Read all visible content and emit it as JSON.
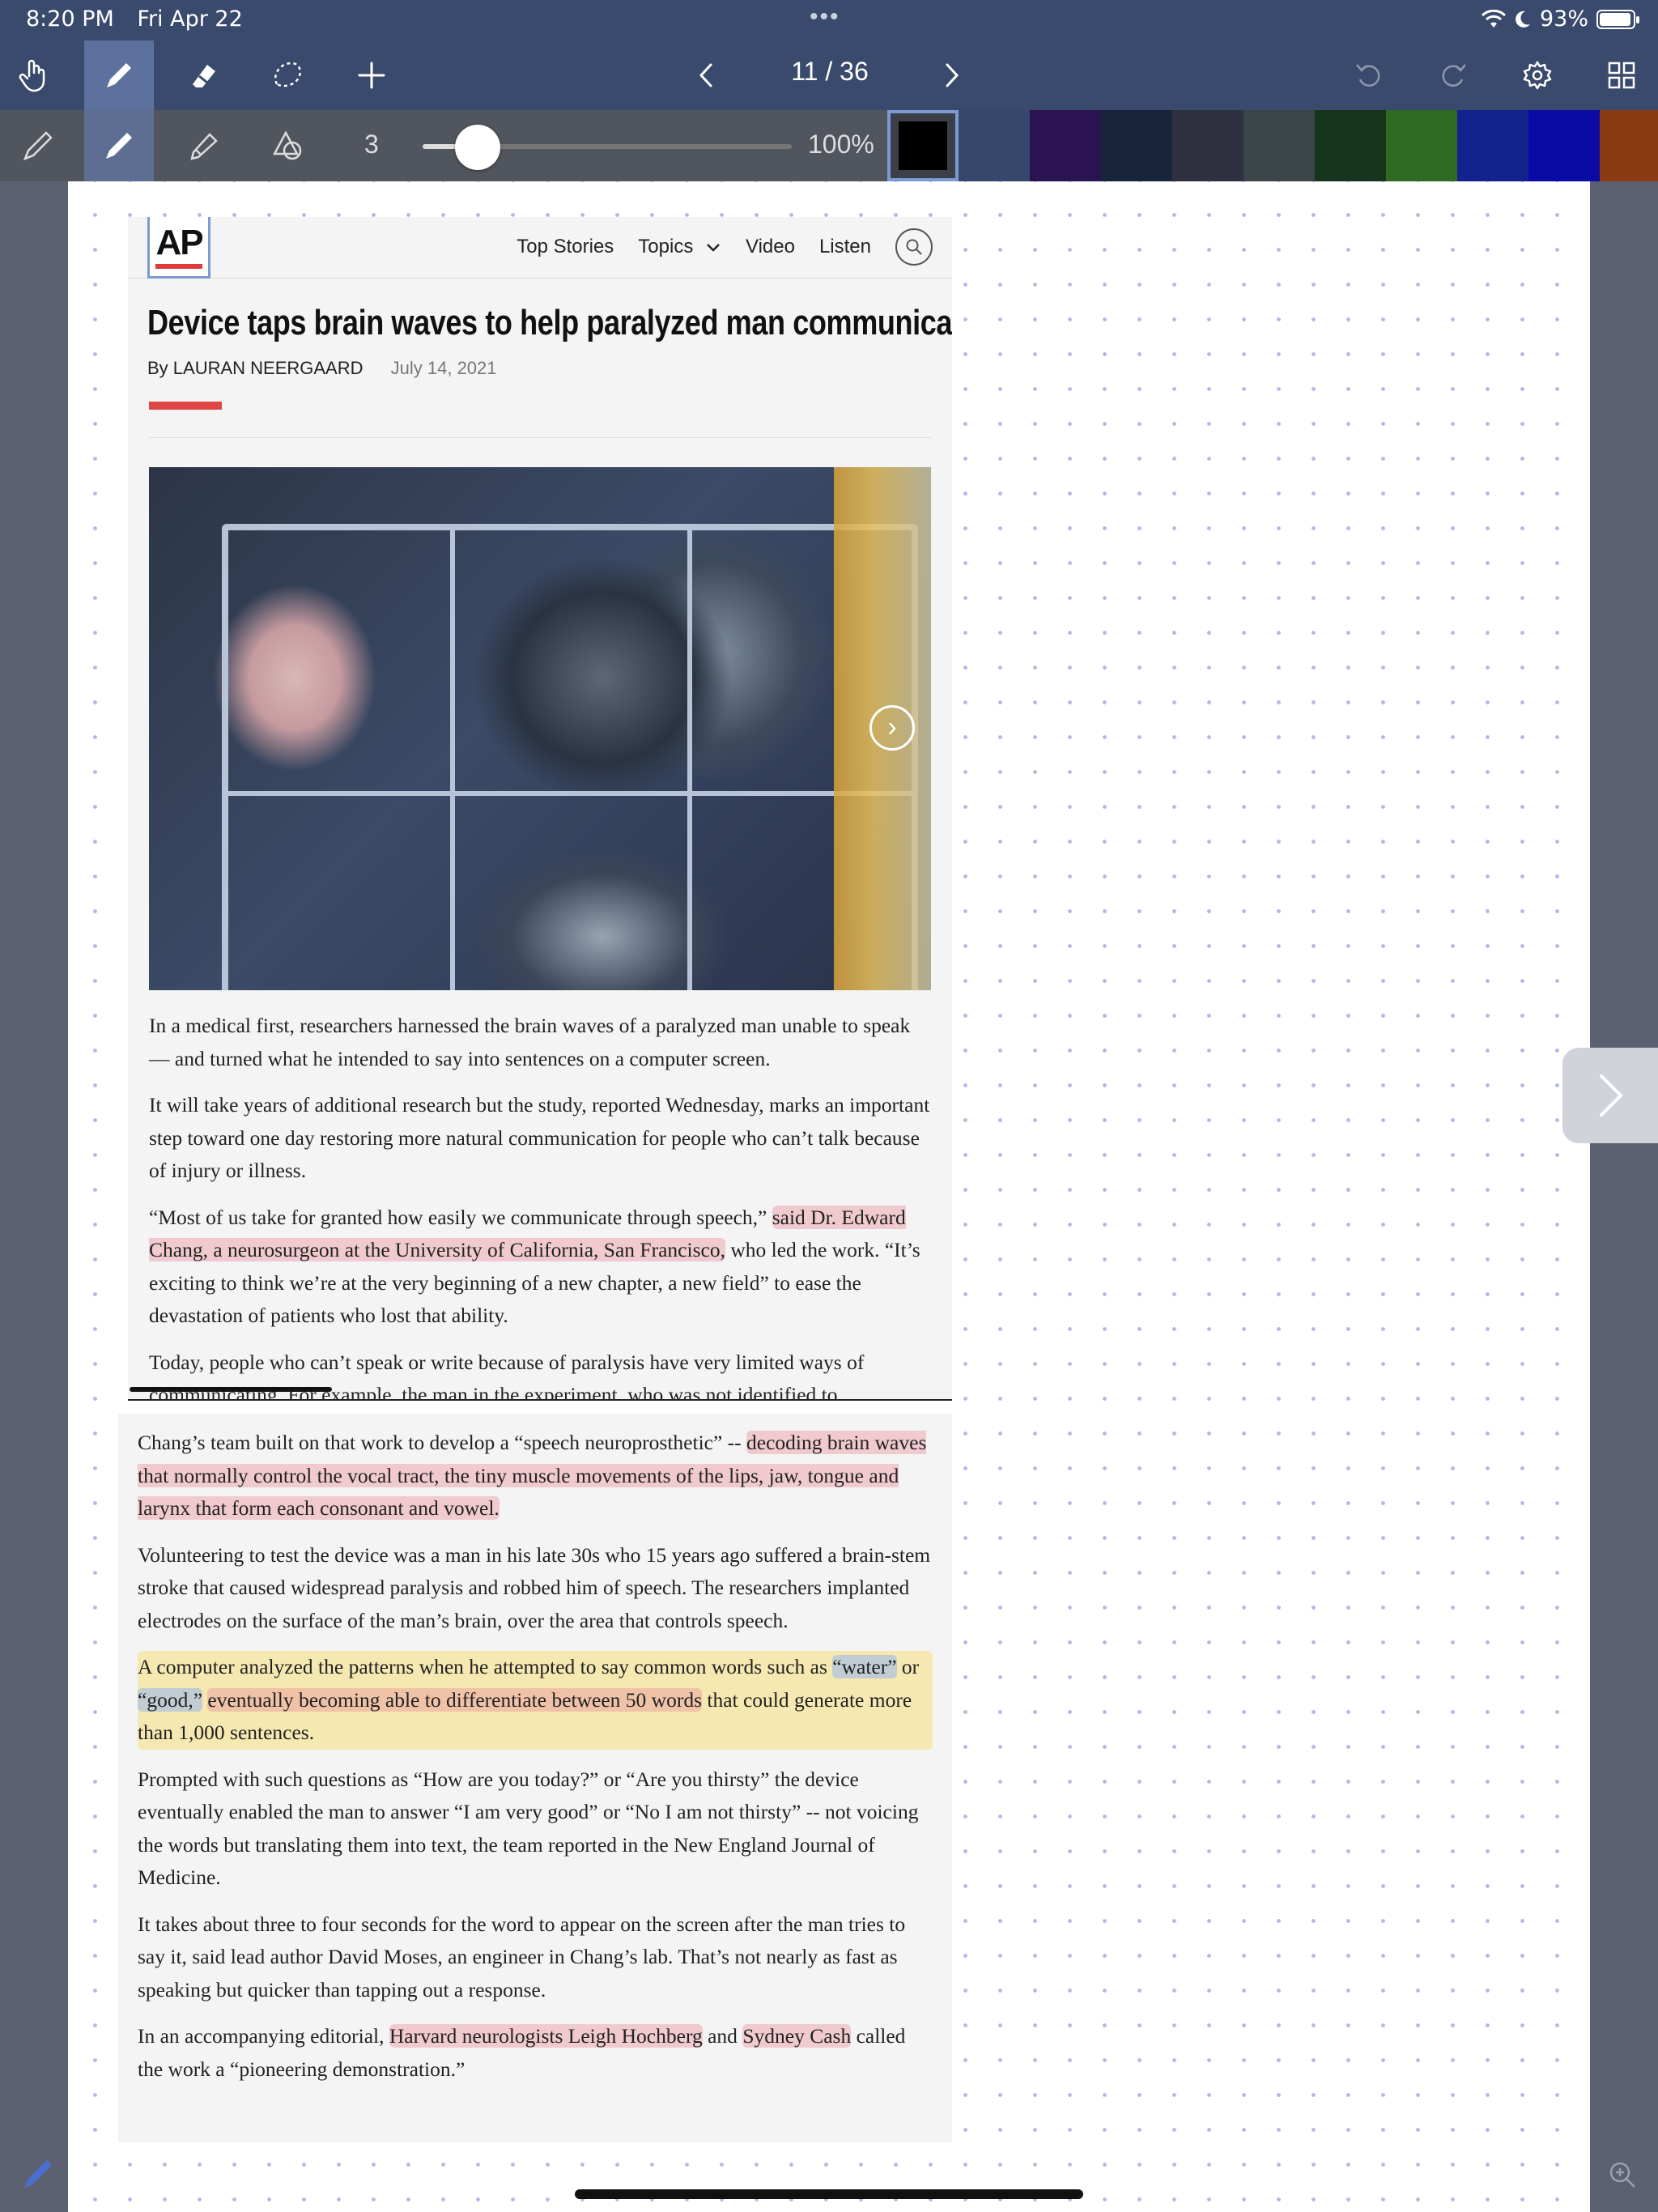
{
  "status_bar": {
    "time": "8:20 PM",
    "date": "Fri Apr 22",
    "dots": "•••",
    "battery": "93%"
  },
  "toolbar": {
    "tools": [
      {
        "name": "hand-tool",
        "icon": "hand-icon",
        "active": false
      },
      {
        "name": "pen-tool",
        "icon": "pen-icon",
        "active": true
      },
      {
        "name": "eraser-tool",
        "icon": "eraser-icon",
        "active": false
      },
      {
        "name": "lasso-tool",
        "icon": "lasso-icon",
        "active": false
      },
      {
        "name": "add-tool",
        "icon": "plus-icon",
        "active": false
      }
    ],
    "page_indicator": "11 / 36",
    "right": [
      "undo-icon",
      "redo-icon",
      "gear-icon",
      "grid-icon"
    ]
  },
  "pen_bar": {
    "pens": [
      "fountain-pen-icon",
      "ballpoint-pen-icon",
      "highlighter-icon",
      "shapes-icon"
    ],
    "size": "3",
    "slider_value": 0.15,
    "opacity": "100%",
    "colors": [
      "#000000",
      "#35476a",
      "#2a1253",
      "#18243a",
      "#2f3040",
      "#3b4549",
      "#15341c",
      "#2e6a22",
      "#12238e",
      "#0a0aa4",
      "#8b3a14"
    ]
  },
  "article1": {
    "logo": "AP",
    "nav": [
      "Top Stories",
      "Topics",
      "Video",
      "Listen"
    ],
    "headline": "Device taps brain waves to help paralyzed man communicate",
    "byline": "By LAURAN NEERGAARD",
    "date": "July 14, 2021",
    "p1": "In a medical first, researchers harnessed the brain waves of a paralyzed man unable to speak — and turned what he intended to say into sentences on a computer screen.",
    "p2": "It will take years of additional research but the study, reported Wednesday, marks an important step toward one day restoring more natural communication for people who can’t talk because of injury or illness.",
    "p3a": "“Most of us take for granted how easily we communicate through speech,” ",
    "p3b": "said Dr. Edward Chang, a neurosurgeon at the University of California, San Francisco,",
    "p3c": " who led the work. “It’s exciting to think we’re at the very beginning of a new chapter, a new field” to ease the devastation of patients who lost that ability.",
    "p4": "Today, people who can’t speak or write because of paralysis have very limited ways of communicating. For example, the man in the experiment, who was not identified to"
  },
  "article2": {
    "p1a": "Chang’s team built on that work to develop a “speech neuroprosthetic” -- ",
    "p1b": "decoding brain waves that normally control the vocal tract, the tiny muscle movements of the lips, jaw, tongue and larynx that form each consonant and vowel.",
    "p2": "Volunteering to test the device was a man in his late 30s who 15 years ago suffered a brain-stem stroke that caused widespread paralysis and robbed him of speech. The researchers implanted electrodes on the surface of the man’s brain, over the area that controls speech.",
    "p3a": "A computer analyzed the patterns when he attempted to say common words such as ",
    "p3b": "“water”",
    "p3c": " or ",
    "p3d": "“good,”",
    "p3e": " ",
    "p3f": "eventually becoming able to differentiate between 50 words",
    "p3g": " that could generate more than 1,000 sentences.",
    "p4": "Prompted with such questions as “How are you today?” or “Are you thirsty” the device eventually enabled the man to answer “I am very good” or “No I am not thirsty” -- not voicing the words but translating them into text, the team reported in the New England Journal of Medicine.",
    "p5": "It takes about three to four seconds for the word to appear on the screen after the man tries to say it, said lead author David Moses, an engineer in Chang’s lab. That’s not nearly as fast as speaking but quicker than tapping out a response.",
    "p6a": "In an accompanying editorial, ",
    "p6b": "Harvard neurologists Leigh Hochberg",
    "p6c": " and ",
    "p6d": "Sydney Cash",
    "p6e": " called the work a “pioneering demonstration.”"
  }
}
